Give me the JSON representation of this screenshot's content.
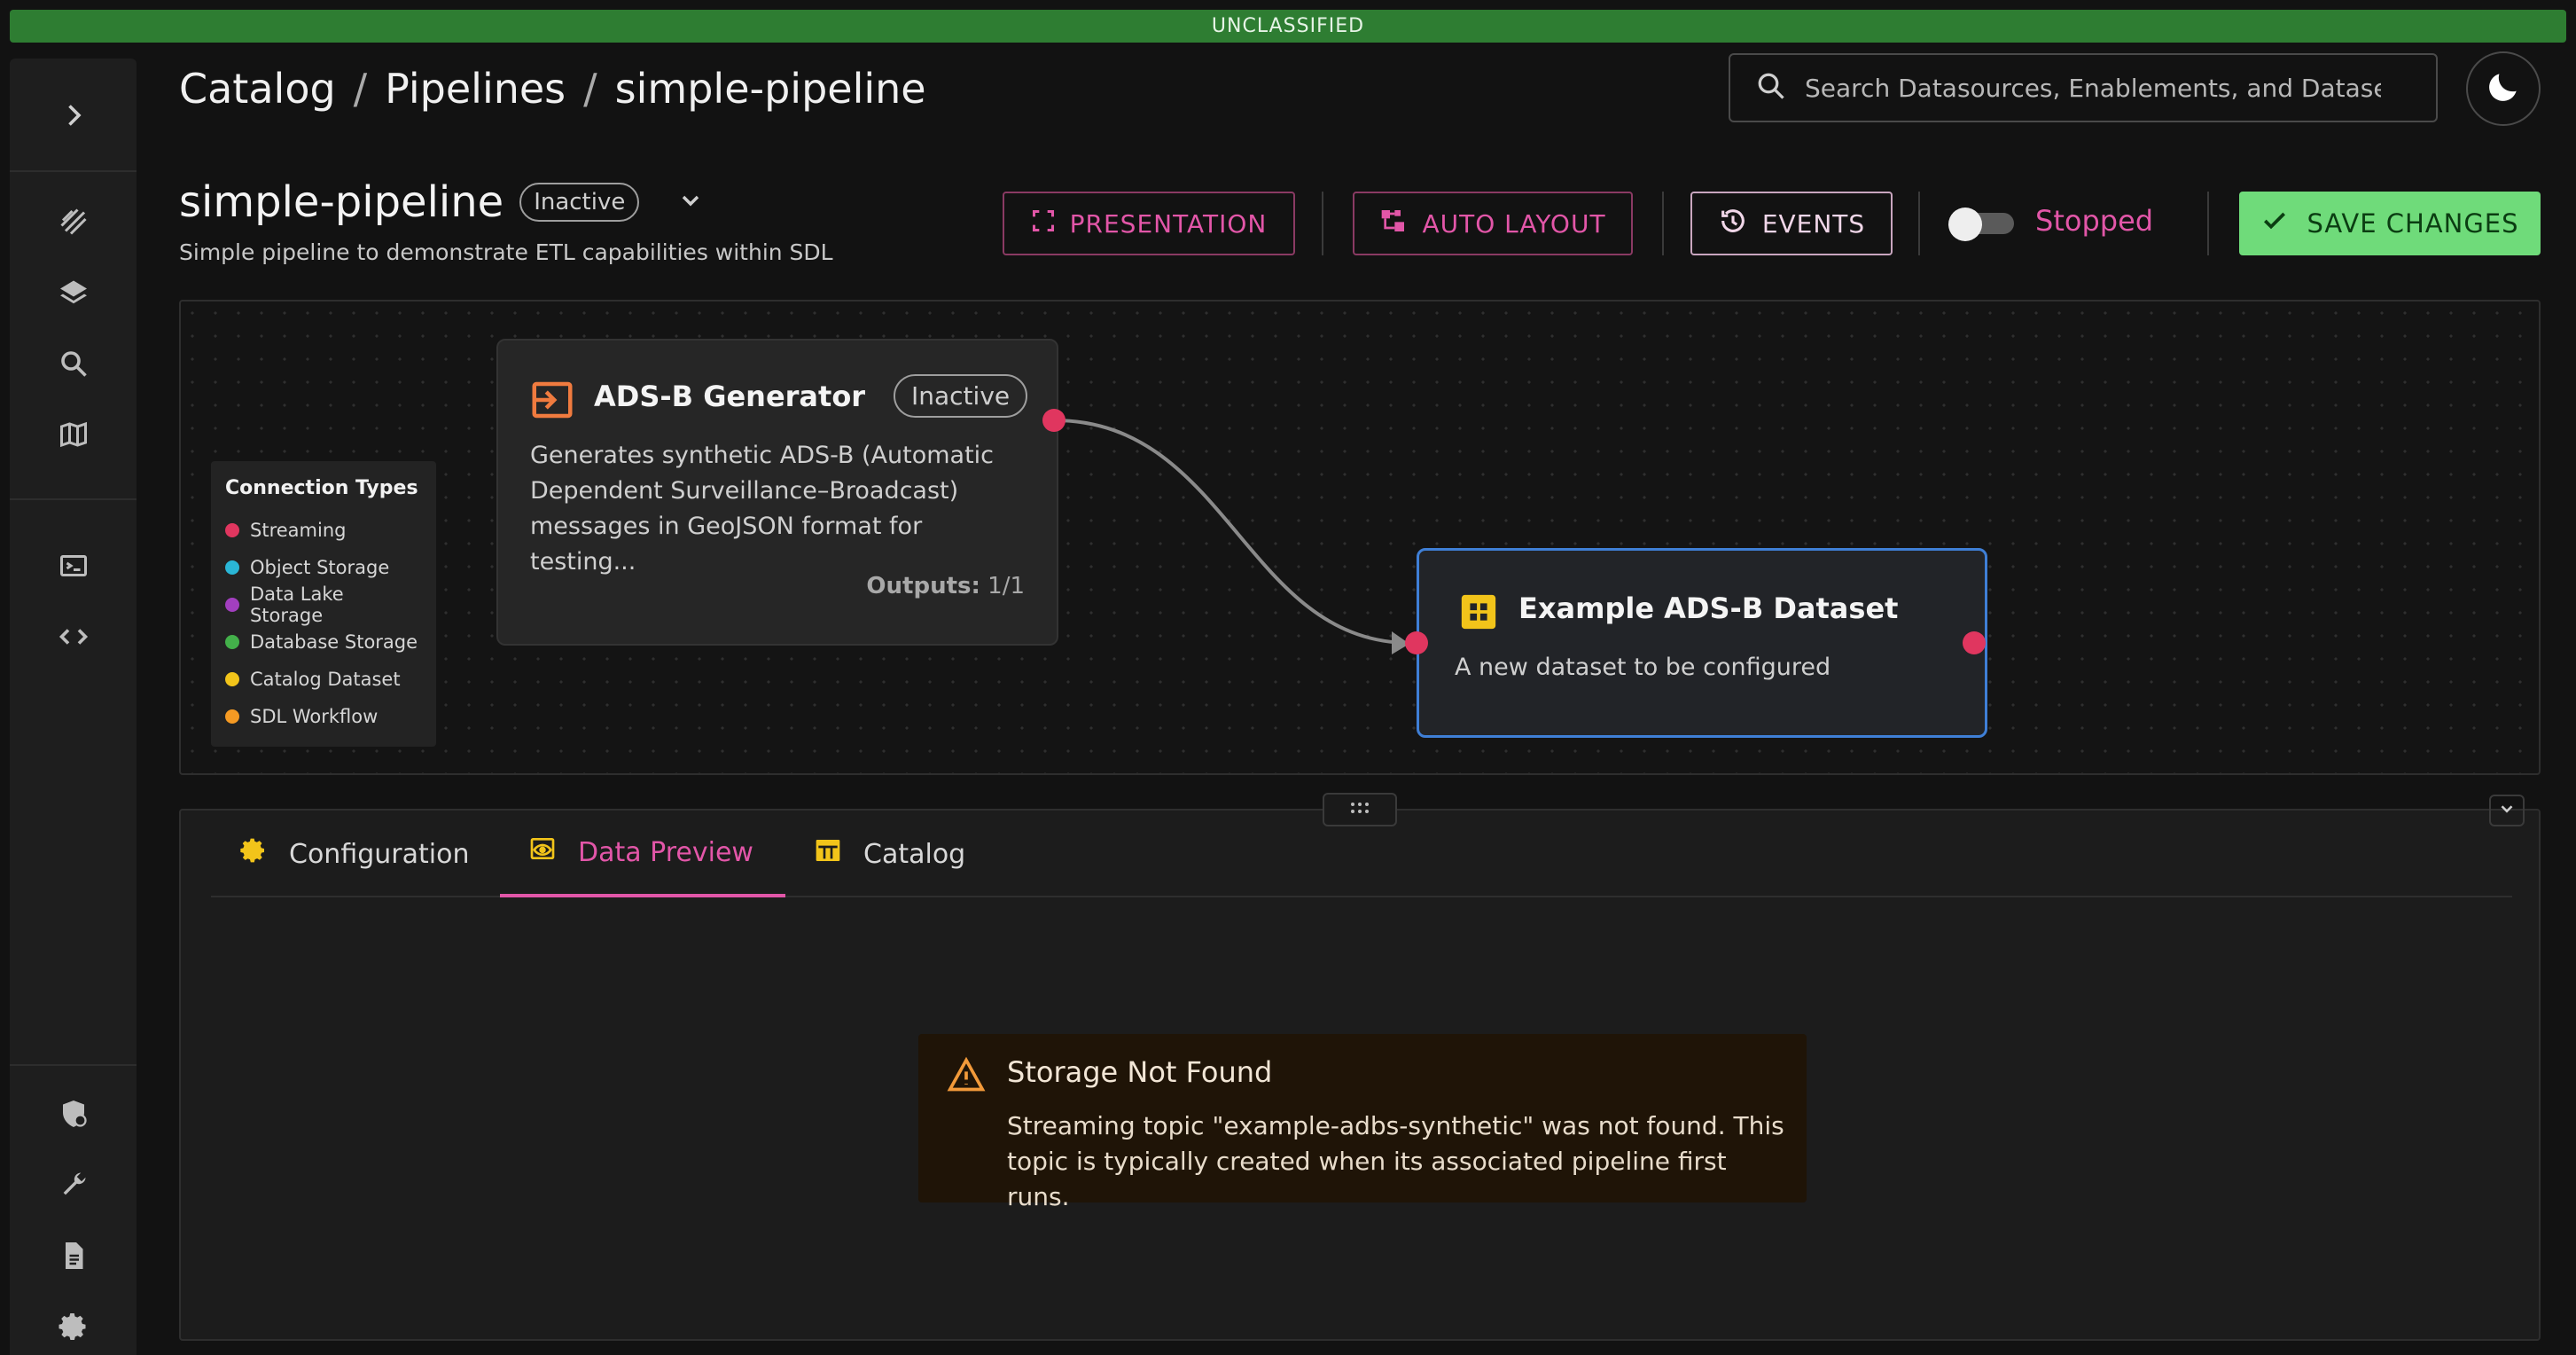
{
  "banner": {
    "text": "UNCLASSIFIED"
  },
  "breadcrumb": {
    "items": [
      "Catalog",
      "Pipelines",
      "simple-pipeline"
    ],
    "separator": "/"
  },
  "search": {
    "placeholder": "Search Datasources, Enablements, and Datasets"
  },
  "header": {
    "title": "simple-pipeline",
    "status": "Inactive",
    "subtitle": "Simple pipeline to demonstrate ETL capabilities within SDL"
  },
  "toolbar": {
    "presentation": "PRESENTATION",
    "auto_layout": "AUTO LAYOUT",
    "events": "EVENTS",
    "run_state": "Stopped",
    "save": "SAVE CHANGES"
  },
  "legend": {
    "title": "Connection Types",
    "items": [
      {
        "label": "Streaming",
        "color": "#e0365f"
      },
      {
        "label": "Object Storage",
        "color": "#2ab6d6"
      },
      {
        "label": "Data Lake Storage",
        "color": "#a23fbf"
      },
      {
        "label": "Database Storage",
        "color": "#43b04a"
      },
      {
        "label": "Catalog Dataset",
        "color": "#f2c41a"
      },
      {
        "label": "SDL Workflow",
        "color": "#f59a23"
      }
    ]
  },
  "nodes": {
    "generator": {
      "title": "ADS-B Generator",
      "status": "Inactive",
      "description": "Generates synthetic ADS-B (Automatic Dependent Surveillance–Broadcast) messages in GeoJSON format for testing...",
      "outputs_label": "Outputs:",
      "outputs_value": "1/1"
    },
    "dataset": {
      "title": "Example ADS-B Dataset",
      "description": "A new dataset to be configured"
    }
  },
  "tabs": [
    {
      "label": "Configuration"
    },
    {
      "label": "Data Preview"
    },
    {
      "label": "Catalog"
    }
  ],
  "alert": {
    "title": "Storage Not Found",
    "body": "Streaming topic \"example-adbs-synthetic\" was not found. This topic is typically created when its associated pipeline first runs."
  },
  "colors": {
    "accent": "#e256a8",
    "save": "#6fdb7a",
    "banner": "#2e7d32",
    "selected_node": "#3f7fd6",
    "port": "#e0365f",
    "fab": "#c8369b"
  }
}
